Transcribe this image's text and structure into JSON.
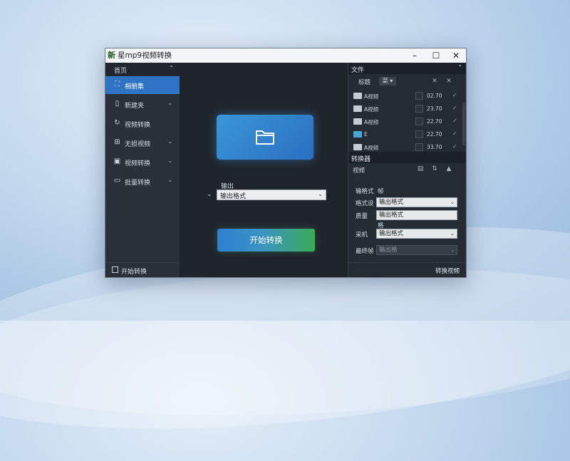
{
  "window": {
    "app_icon_char": "新",
    "title": "星mp9视频转换",
    "controls": [
      "–",
      "☐",
      "✕"
    ]
  },
  "sidebar": {
    "header": "首页",
    "items": [
      {
        "label": "相册集",
        "icon": "image-icon",
        "glyph": "⛶",
        "has_chevron": false,
        "active": true
      },
      {
        "label": "新建夹",
        "icon": "file-icon",
        "glyph": "▯",
        "has_chevron": true,
        "active": false
      },
      {
        "label": "视频转换",
        "icon": "convert-icon",
        "glyph": "↻",
        "has_chevron": false,
        "active": false
      },
      {
        "label": "无损视频",
        "icon": "video-icon",
        "glyph": "⊞",
        "has_chevron": true,
        "active": false
      },
      {
        "label": "视频转换",
        "icon": "film-icon",
        "glyph": "▣",
        "has_chevron": true,
        "active": false
      },
      {
        "label": "批量转换",
        "icon": "window-icon",
        "glyph": "▭",
        "has_chevron": true,
        "active": false
      }
    ],
    "footer": "开始转换"
  },
  "main": {
    "output_label": "输出",
    "output_select": "输出格式",
    "start_button": "开始转换"
  },
  "files_panel": {
    "title": "文件",
    "toolbar_label": "标题",
    "toolbar_button": "菜 ▾",
    "toolbar_icons": [
      "✕",
      "✕"
    ],
    "rows": [
      {
        "name": "A视频",
        "size": "02.70",
        "status": "✓",
        "icon_color": "gray"
      },
      {
        "name": "A视频",
        "size": "23.70",
        "status": "✓",
        "icon_color": "gray"
      },
      {
        "name": "A视频",
        "size": "22.70",
        "status": "✓",
        "icon_color": "blue"
      },
      {
        "name": "E",
        "size": "22.70",
        "status": "✓",
        "icon_color": "gray"
      },
      {
        "name": "A视频",
        "size": "33.70",
        "status": "✓",
        "icon_color": "gray"
      }
    ]
  },
  "convert_panel": {
    "title": "转换器",
    "sub_label": "视频",
    "sub_icons": [
      "▤",
      "⇅",
      "▲"
    ],
    "props": [
      {
        "label": "输格式",
        "value": "帧",
        "kind": "plain"
      },
      {
        "label": "格式设",
        "value": "输出格式",
        "kind": "select"
      },
      {
        "label": "质量",
        "value": "输出格式",
        "kind": "select"
      },
      {
        "label": "",
        "value": "格",
        "kind": "plain"
      },
      {
        "label": "采机",
        "value": "输出格式",
        "kind": "select"
      },
      {
        "label": "最终帧",
        "value": "输出格",
        "kind": "disabled"
      }
    ],
    "status": "转换视频"
  }
}
